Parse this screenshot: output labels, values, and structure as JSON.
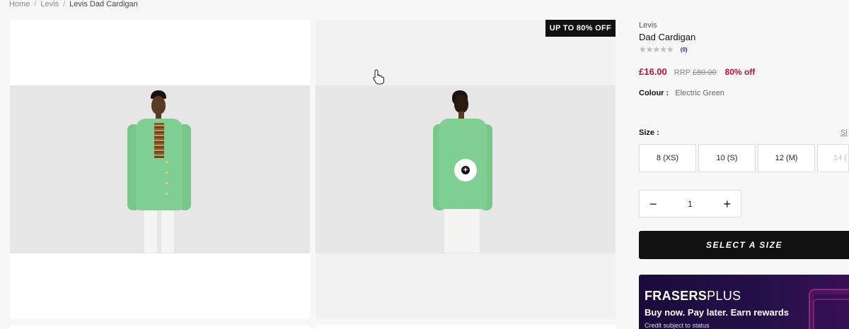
{
  "breadcrumb": {
    "home": "Home",
    "brand": "Levis",
    "current": "Levis Dad Cardigan",
    "separator": "/"
  },
  "gallery": {
    "promo_badge": "UP TO 80% OFF",
    "zoom_icon": "plus-circle-icon",
    "cursor_icon": "hand-pointer-icon"
  },
  "product": {
    "brand": "Levis",
    "name": "Dad Cardigan",
    "stars": "★★★★★",
    "rating": 0,
    "review_count": "(0)",
    "price": "£16.00",
    "rrp_label": "RRP",
    "rrp_value": "£80.00",
    "discount": "80% off",
    "colour_label": "Colour :",
    "colour_value": "Electric Green"
  },
  "sizes": {
    "label": "Size :",
    "guide_link": "Si",
    "options": [
      {
        "label": "8 (XS)",
        "available": true
      },
      {
        "label": "10 (S)",
        "available": true
      },
      {
        "label": "12 (M)",
        "available": true
      },
      {
        "label": "14 (",
        "available": false
      }
    ]
  },
  "quantity": {
    "minus": "−",
    "value": "1",
    "plus": "+"
  },
  "cta": {
    "label": "SELECT A SIZE"
  },
  "frasers": {
    "brand_bold": "FRASERS",
    "brand_light": "PLUS",
    "tagline": "Buy now. Pay later. Earn rewards",
    "note": "Credit subject to status"
  },
  "colors": {
    "accent_red": "#c8102e",
    "cardigan_green": "#7fcf93",
    "cta_black": "#111111",
    "frasers_purple": "#1a0b3b"
  }
}
